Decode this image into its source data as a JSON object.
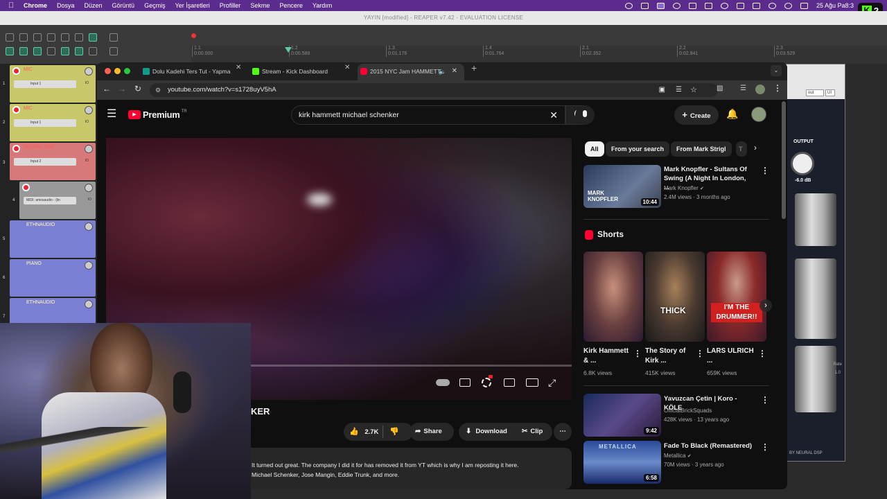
{
  "menubar": {
    "items": [
      "Chrome",
      "Dosya",
      "Düzen",
      "Görüntü",
      "Geçmiş",
      "Yer İşaretleri",
      "Profiller",
      "Sekme",
      "Pencere",
      "Yardım"
    ],
    "clock": "25 Ağu Pa",
    "clock_tail": "8:3",
    "kick_badge": "2",
    "kick_letter": "K"
  },
  "reaper": {
    "title": "YAYIN [modified] - REAPER v7.42 - EVALUATION LICENSE",
    "timeline": [
      {
        "bar": "1.1",
        "time": "0:00.000"
      },
      {
        "bar": "1.2",
        "time": "0:00.588"
      },
      {
        "bar": "1.3",
        "time": "0:01.176"
      },
      {
        "bar": "1.4",
        "time": "0:01.764"
      },
      {
        "bar": "2.1",
        "time": "0:02.352"
      },
      {
        "bar": "2.2",
        "time": "0:02.941"
      },
      {
        "bar": "2.3",
        "time": "0:03.529"
      }
    ],
    "tracks": [
      {
        "num": "1",
        "name": "MIC",
        "input": "Input 1",
        "color": "#c8c86a",
        "io": "IO"
      },
      {
        "num": "2",
        "name": "MIC",
        "input": "Input 1",
        "color": "#c8c86a",
        "io": "IO"
      },
      {
        "num": "3",
        "name": "NEURAL DSP",
        "input": "Input 2",
        "color": "#d7787a",
        "io": "IO"
      },
      {
        "num": "4",
        "name": "",
        "input": "MIDI: amosaudio - (lin",
        "color": "#999999",
        "io": "IO"
      },
      {
        "num": "5",
        "name": "ETHNAUDIO",
        "input": "",
        "color": "#7b7fd4",
        "io": ""
      },
      {
        "num": "6",
        "name": "PIANO",
        "input": "",
        "color": "#7b7fd4",
        "io": ""
      },
      {
        "num": "7",
        "name": "ETHNAUDIO",
        "input": "",
        "color": "#7b7fd4",
        "io": ""
      }
    ]
  },
  "plugin": {
    "output_label": "OUTPUT",
    "output_value": "-6.0 dB",
    "brand": "BY NEURAL DSP",
    "rate_label": "Rate",
    "rate_value": "1.0",
    "top_btn1": "out",
    "top_btn2": "UI"
  },
  "browser": {
    "tabs": [
      {
        "title": "Dolu Kadehi Ters Tut - Yapma",
        "fav_color": "#0f9d8a",
        "active": false
      },
      {
        "title": "Stream - Kick Dashboard",
        "fav_color": "#53fc18",
        "active": false
      },
      {
        "title": "2015 NYC Jam HAMMETT",
        "fav_color": "#ff0033",
        "active": true
      }
    ],
    "url": "youtube.com/watch?v=s1728uyV5hA"
  },
  "youtube": {
    "logo": "Premium",
    "logo_sup": "TR",
    "search_query": "kirk hammett michael schenker",
    "create_label": "Create",
    "video_title_partial": "KER",
    "like_count": "2.7K",
    "share_label": "Share",
    "download_label": "Download",
    "clip_label": "Clip",
    "description_line1": "It turned out great.  The company I did it for has removed it from YT which is why I am reposting it here.",
    "description_line2": "Michael Schenker, Jose Mangin, Eddie Trunk, and more.",
    "chips": [
      "All",
      "From your search",
      "From Mark Strigl",
      "T"
    ],
    "shorts_title": "Shorts",
    "recommended": [
      {
        "title": "Mark Knopfler - Sultans Of Swing (A Night In London, ...",
        "channel": "Mark Knopfler",
        "meta": "2.4M views · 3 months ago",
        "duration": "10:44",
        "verified": true,
        "thumb_text": "MARK KNOPFLER"
      },
      {
        "title": "Yavuzcan Çetin | Koro - KÖLE",
        "channel": "OfficialBrickSquads",
        "meta": "428K views · 13 years ago",
        "duration": "9:42",
        "verified": false,
        "thumb_text": ""
      },
      {
        "title": "Fade To Black (Remastered)",
        "channel": "Metallica",
        "meta": "70M views · 3 years ago",
        "duration": "6:58",
        "verified": true,
        "thumb_text": "METALLICA"
      }
    ],
    "shorts": [
      {
        "title": "Kirk Hammett & ...",
        "views": "6.8K views",
        "overlay": ""
      },
      {
        "title": "The Story of Kirk ...",
        "views": "415K views",
        "overlay": "THICK"
      },
      {
        "title": "LARS ULRICH ...",
        "views": "659K views",
        "overlay": "I'M THE DRUMMER!!"
      }
    ]
  },
  "colors": {
    "accent": "#ff0033",
    "menubar": "#5b2c8e",
    "kick": "#53fc18"
  }
}
